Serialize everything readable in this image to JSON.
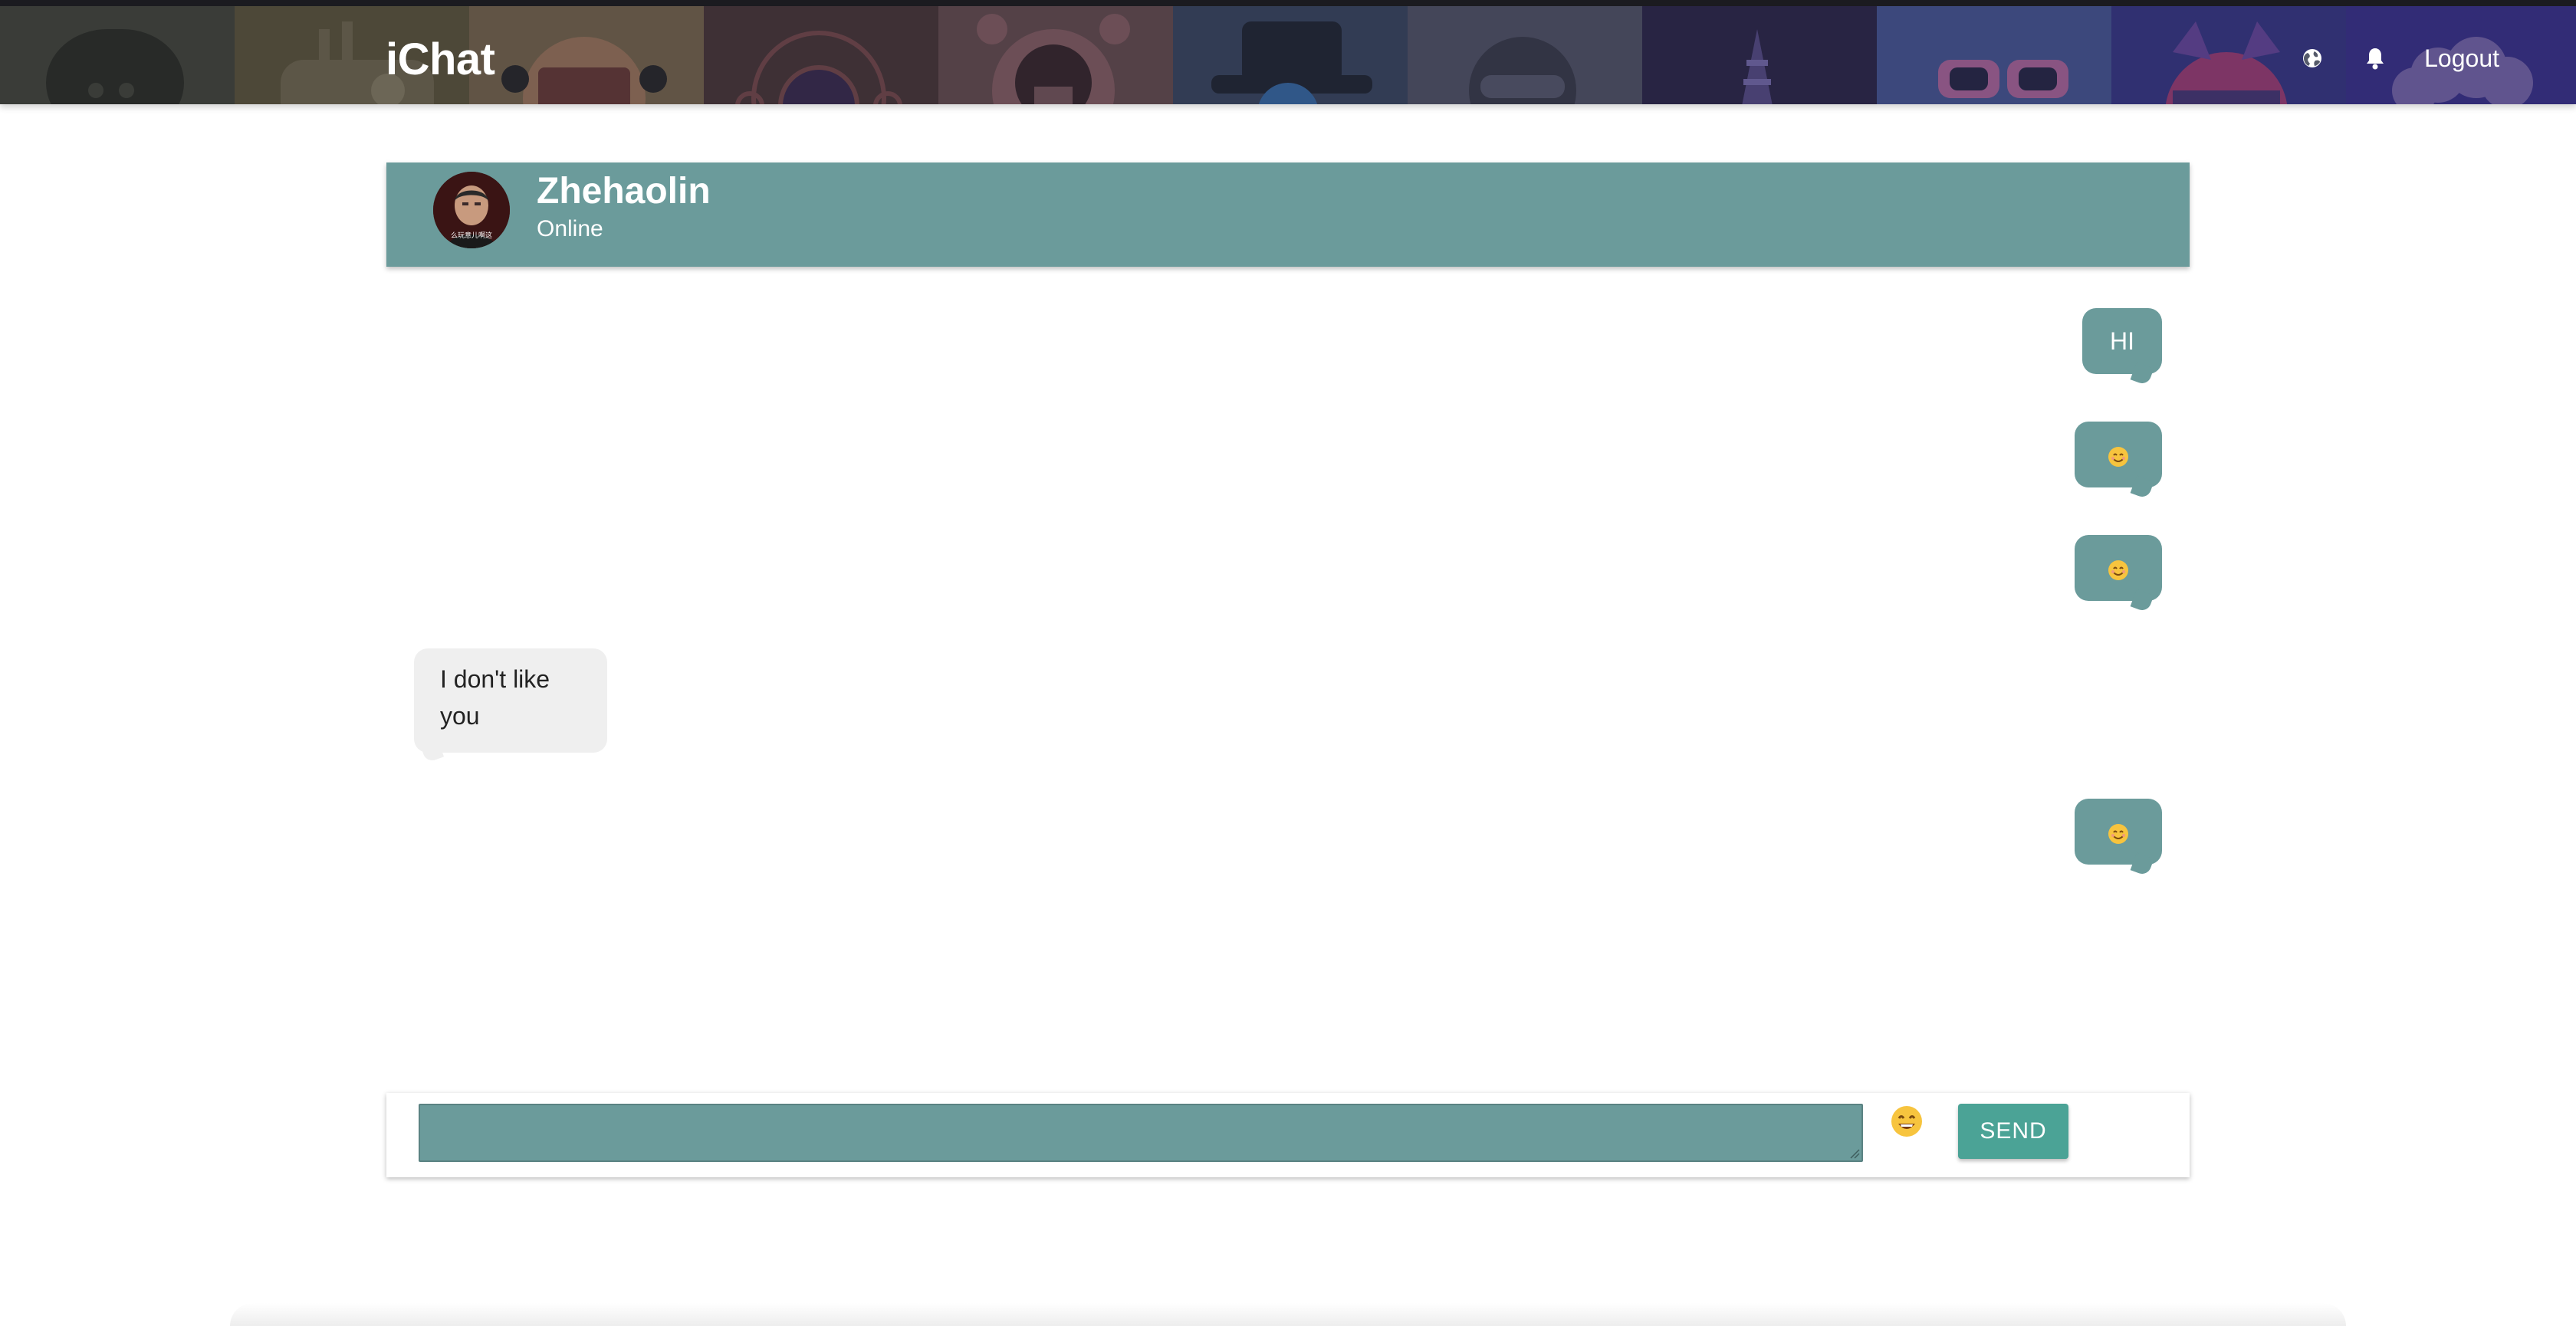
{
  "navbar": {
    "brand": "iChat",
    "logout_label": "Logout",
    "icons": [
      "globe-icon",
      "bell-icon"
    ],
    "tile_colors": [
      "#474a3e",
      "#615a3e",
      "#7b6a4f",
      "#4d3a3a",
      "#6a5052",
      "#3d4a63",
      "#54576a",
      "#2f2a4d",
      "#4a5a98",
      "#3a3a8a",
      "#3d3590"
    ]
  },
  "chat": {
    "name": "Zhehaolin",
    "status": "Online",
    "avatar_caption": "么玩意儿啊这"
  },
  "messages": [
    {
      "sender": "me",
      "text": "HI"
    },
    {
      "sender": "me",
      "emoji": "smile-emoji"
    },
    {
      "sender": "me",
      "emoji": "smile-emoji"
    },
    {
      "sender": "them",
      "text": "I don't like you"
    },
    {
      "sender": "me",
      "emoji": "smile-emoji"
    }
  ],
  "composer": {
    "value": "",
    "emoji_button": "grin-emoji-icon",
    "send_label": "SEND"
  },
  "colors": {
    "header_teal": "#6b9b9b",
    "send_button": "#4ba396",
    "incoming_bubble": "#efefef"
  }
}
